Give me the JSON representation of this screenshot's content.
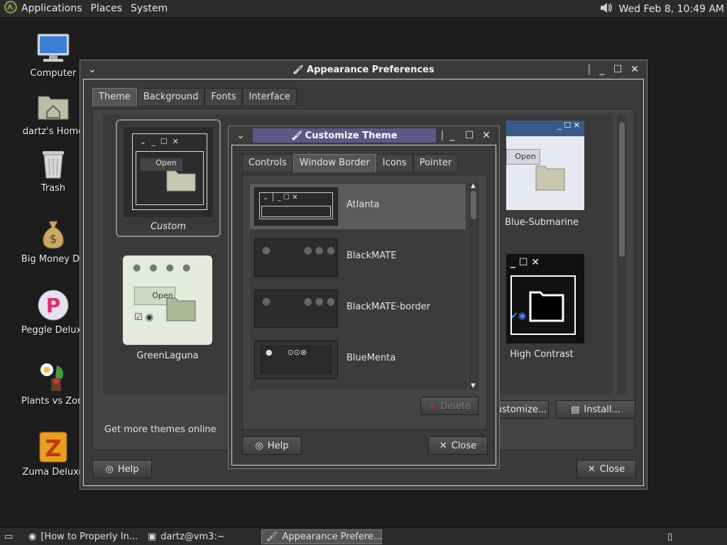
{
  "panel": {
    "menus": [
      "Applications",
      "Places",
      "System"
    ],
    "clock": "Wed Feb  8, 10:49 AM"
  },
  "desktop": {
    "icons": [
      {
        "label": "Computer",
        "icon": "computer-icon"
      },
      {
        "label": "dartz's Home",
        "icon": "home-folder-icon"
      },
      {
        "label": "Trash",
        "icon": "trash-icon"
      },
      {
        "label": "Big Money Deluxe",
        "icon": "money-bag-icon"
      },
      {
        "label": "Peggle Deluxe",
        "icon": "peggle-icon"
      },
      {
        "label": "Plants vs Zombies",
        "icon": "plants-icon"
      },
      {
        "label": "Zuma Deluxe",
        "icon": "zuma-icon"
      }
    ]
  },
  "appearance": {
    "title": "Appearance Preferences",
    "tabs": [
      "Theme",
      "Background",
      "Fonts",
      "Interface"
    ],
    "themes": [
      {
        "name": "Custom"
      },
      {
        "name": "GreenLaguna"
      },
      {
        "name": "Blue-Submarine"
      },
      {
        "name": "High Contrast"
      }
    ],
    "preview_open": "Open",
    "get_more": "Get more themes online",
    "customize_label": "Customize...",
    "install_label": "Install...",
    "help_label": "Help",
    "close_label": "Close"
  },
  "customize": {
    "title": "Customize Theme",
    "tabs": [
      "Controls",
      "Window Border",
      "Icons",
      "Pointer"
    ],
    "borders": [
      "Atlanta",
      "BlackMATE",
      "BlackMATE-border",
      "BlueMenta"
    ],
    "delete_label": "Delete",
    "help_label": "Help",
    "close_label": "Close"
  },
  "taskbar": {
    "tasks": [
      "[How to Properly In...",
      "dartz@vm3:~",
      "Appearance Prefere..."
    ]
  },
  "colors": {
    "selected_row": "#5c5c5c",
    "title_highlight": "#5a5a8a"
  }
}
